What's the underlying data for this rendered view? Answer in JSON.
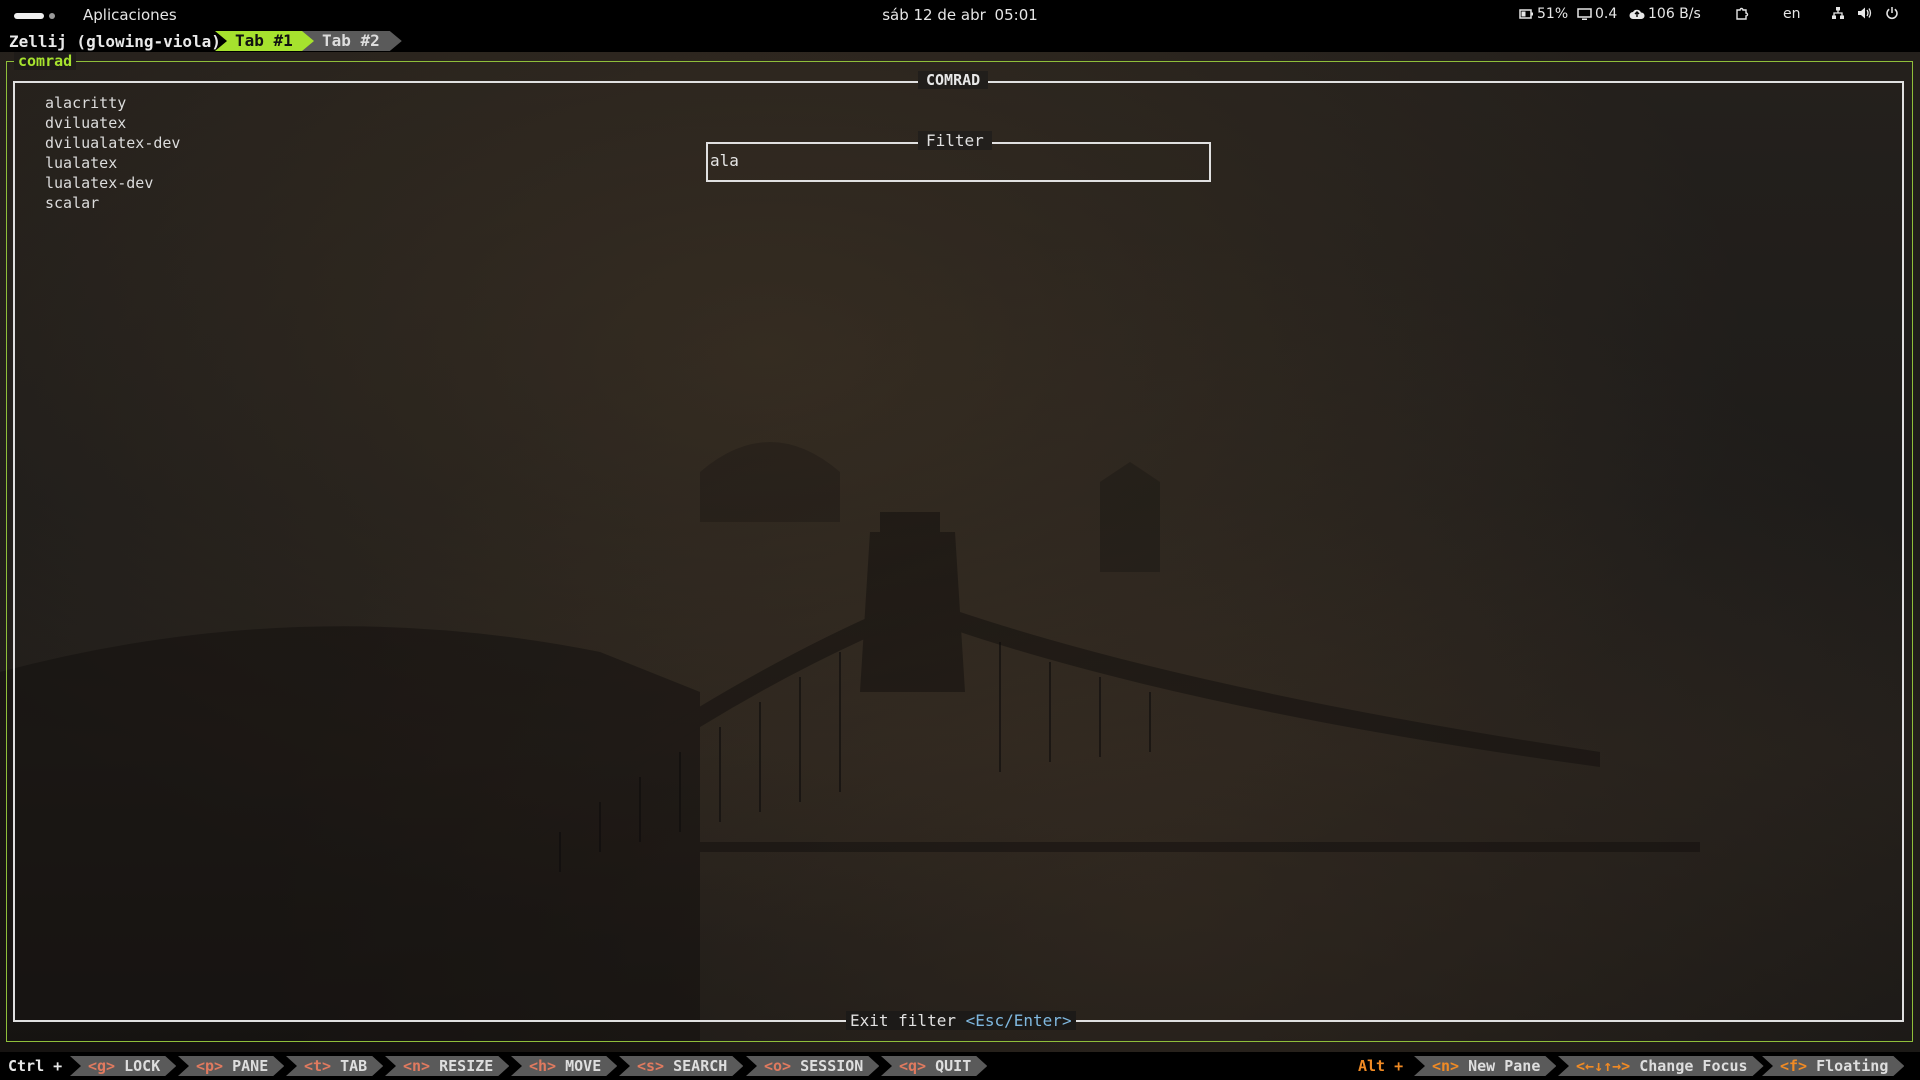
{
  "gnome_bar": {
    "apps_label": "Aplicaciones",
    "date": "sáb 12 de abr",
    "time": "05:01",
    "battery": "51%",
    "load": "0.4",
    "net_speed": "106 B/s",
    "lang": "en"
  },
  "zellij": {
    "session": "Zellij (glowing-viola)",
    "tabs": [
      {
        "label": "Tab #1",
        "active": true
      },
      {
        "label": "Tab #2",
        "active": false
      }
    ]
  },
  "pane": {
    "title": "comrad",
    "inner_title": "COMRAD",
    "items": [
      "alacritty",
      "dviluatex",
      "dvilualatex-dev",
      "lualatex",
      "lualatex-dev",
      "scalar"
    ],
    "filter_title": "Filter",
    "filter_value": "ala",
    "exit_label": "Exit filter",
    "exit_keys": "<Esc/Enter>"
  },
  "status": {
    "ctrl_label": "Ctrl +",
    "ctrl_items": [
      {
        "key": "<g>",
        "label": "LOCK"
      },
      {
        "key": "<p>",
        "label": "PANE"
      },
      {
        "key": "<t>",
        "label": "TAB"
      },
      {
        "key": "<n>",
        "label": "RESIZE"
      },
      {
        "key": "<h>",
        "label": "MOVE"
      },
      {
        "key": "<s>",
        "label": "SEARCH"
      },
      {
        "key": "<o>",
        "label": "SESSION"
      },
      {
        "key": "<q>",
        "label": "QUIT"
      }
    ],
    "alt_label": "Alt +",
    "alt_items": [
      {
        "key": "<n>",
        "label": "New Pane"
      },
      {
        "key": "<←↓↑→>",
        "label": "Change Focus"
      },
      {
        "key": "<f>",
        "label": "Floating"
      }
    ]
  },
  "colors": {
    "accent": "#a6e22e",
    "alt_mod": "#f08a24",
    "key_hint": "#7fb8e0"
  }
}
